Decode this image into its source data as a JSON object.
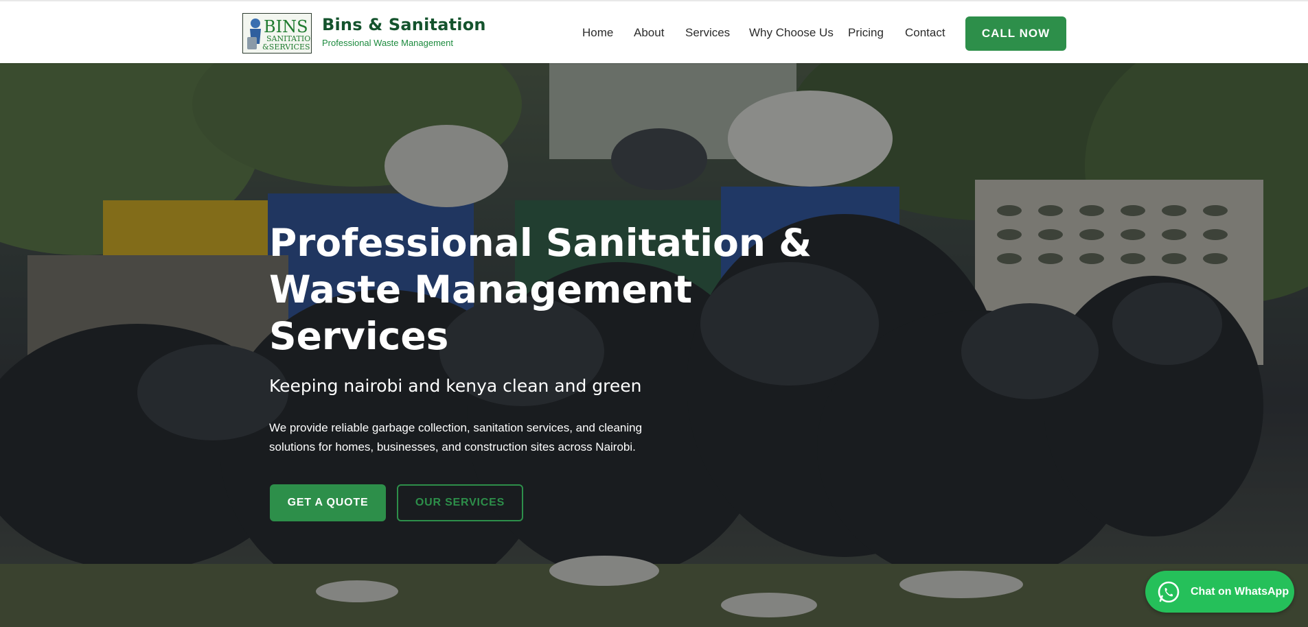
{
  "header": {
    "brand_title": "Bins & Sanitation",
    "brand_subtitle": "Professional Waste Management",
    "logo_text": "BINS SANITATION & SERVICES",
    "nav": [
      {
        "label": "Home"
      },
      {
        "label": "About"
      },
      {
        "label": "Services"
      },
      {
        "label": "Why Choose Us"
      },
      {
        "label": "Pricing"
      },
      {
        "label": "Contact"
      }
    ],
    "cta_label": "CALL NOW"
  },
  "hero": {
    "title": "Professional Sanitation & Waste Management Services",
    "tagline": "Keeping nairobi and kenya clean and green",
    "description": "We provide reliable garbage collection, sanitation services, and cleaning solutions for homes, businesses, and construction sites across Nairobi.",
    "primary_button": "GET A QUOTE",
    "secondary_button": "OUR SERVICES"
  },
  "whatsapp": {
    "label": "Chat on WhatsApp",
    "icon": "whatsapp-icon"
  },
  "colors": {
    "brand_green": "#2d8f4a",
    "brand_dark_green": "#14532d",
    "whatsapp_green": "#25c05a"
  }
}
